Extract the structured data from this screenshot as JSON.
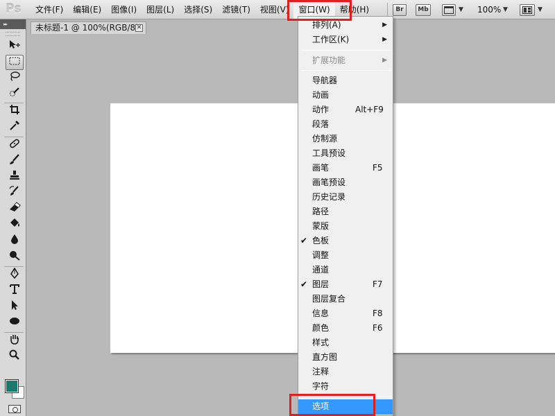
{
  "app": {
    "logo": "Ps",
    "menu": [
      {
        "label": "文件(F)"
      },
      {
        "label": "编辑(E)"
      },
      {
        "label": "图像(I)"
      },
      {
        "label": "图层(L)"
      },
      {
        "label": "选择(S)"
      },
      {
        "label": "滤镜(T)"
      },
      {
        "label": "视图(V)"
      },
      {
        "label": "窗口(W)"
      },
      {
        "label": "帮助(H)"
      }
    ],
    "active_menu": "窗口(W)",
    "toolbar_buttons": {
      "bridge": "Br",
      "minibridge": "Mb",
      "zoom_level": "100%"
    }
  },
  "document": {
    "tab_title": "未标题-1 @ 100%(RGB/8)",
    "close_glyph": "✕"
  },
  "colors": {
    "foreground": "#1b7a70",
    "background": "#ffffff",
    "highlight_box": "#e21f1f",
    "menu_hover": "#3399ff"
  },
  "window_menu": {
    "items": [
      {
        "label": "排列(A)",
        "submenu": true
      },
      {
        "label": "工作区(K)",
        "submenu": true
      },
      {
        "label": "扩展功能",
        "submenu": true,
        "disabled": true
      },
      {
        "label": "导航器"
      },
      {
        "label": "动画"
      },
      {
        "label": "动作",
        "shortcut": "Alt+F9"
      },
      {
        "label": "段落"
      },
      {
        "label": "仿制源"
      },
      {
        "label": "工具预设"
      },
      {
        "label": "画笔",
        "shortcut": "F5"
      },
      {
        "label": "画笔预设"
      },
      {
        "label": "历史记录"
      },
      {
        "label": "路径"
      },
      {
        "label": "蒙版"
      },
      {
        "label": "色板",
        "checked": true
      },
      {
        "label": "调整"
      },
      {
        "label": "通道"
      },
      {
        "label": "图层",
        "shortcut": "F7",
        "checked": true
      },
      {
        "label": "图层复合"
      },
      {
        "label": "信息",
        "shortcut": "F8"
      },
      {
        "label": "颜色",
        "shortcut": "F6"
      },
      {
        "label": "样式"
      },
      {
        "label": "直方图"
      },
      {
        "label": "注释"
      },
      {
        "label": "字符"
      },
      {
        "label": "选项",
        "hovered": true
      }
    ]
  }
}
